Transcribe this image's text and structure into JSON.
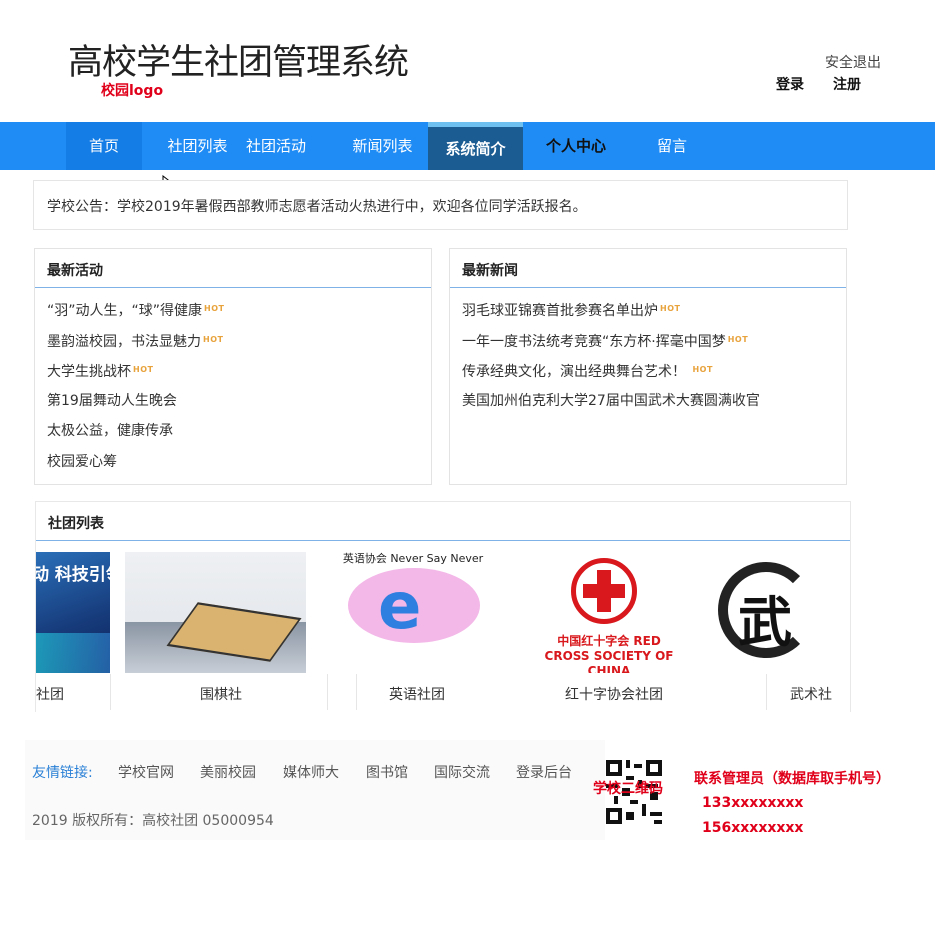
{
  "header": {
    "title": "高校学生社团管理系统",
    "logo_label": "校园logo",
    "logout": "安全退出",
    "login": "登录",
    "register": "注册"
  },
  "nav": {
    "items": [
      {
        "label": "首页"
      },
      {
        "label": "社团列表"
      },
      {
        "label": "社团活动"
      },
      {
        "label": "新闻列表"
      },
      {
        "label": "系统简介"
      },
      {
        "label": "个人中心"
      },
      {
        "label": "留言"
      }
    ],
    "colors": {
      "bar": "#1f8cf5",
      "selected": "#1b5c92"
    }
  },
  "notice": {
    "text": "学校公告：学校2019年暑假西部教师志愿者活动火热进行中，欢迎各位同学活跃报名。"
  },
  "activities": {
    "title": "最新活动",
    "items": [
      {
        "text": "“羽”动人生，“球”得健康",
        "hot": "HOT"
      },
      {
        "text": "墨韵溢校园，书法显魅力",
        "hot": "HOT"
      },
      {
        "text": "大学生挑战杯",
        "hot": "HOT"
      },
      {
        "text": "第19届舞动人生晚会",
        "hot": ""
      },
      {
        "text": "太极公益，健康传承",
        "hot": ""
      },
      {
        "text": "校园爱心筹",
        "hot": ""
      }
    ]
  },
  "news": {
    "title": "最新新闻",
    "items": [
      {
        "text": "羽毛球亚锦赛首批参赛名单出炉",
        "hot": "HOT"
      },
      {
        "text": "一年一度书法统考竞赛“东方杯·挥毫中国梦",
        "hot": "HOT"
      },
      {
        "text": "传承经典文化，演出经典舞台艺术！",
        "hot": "HOT"
      },
      {
        "text": "美国加州伯克利大学27届中国武术大赛圆满收官",
        "hot": ""
      }
    ]
  },
  "clubs": {
    "title": "社团列表",
    "items": [
      {
        "name": "社团",
        "image_text": "动 科技引领"
      },
      {
        "name": "围棋社",
        "image_text": ""
      },
      {
        "name": "英语社团",
        "image_text": "英语协会 Never Say Never"
      },
      {
        "name": "红十字协会社团",
        "image_text": "中国红十字会 RED CROSS SOCIETY OF CHINA"
      },
      {
        "name": "武术社",
        "image_text": "武"
      }
    ]
  },
  "footer": {
    "links_label": "友情链接:",
    "links": [
      "学校官网",
      "美丽校园",
      "媒体师大",
      "图书馆",
      "国际交流",
      "登录后台"
    ],
    "copyright": "2019 版权所有：高校社团 05000954",
    "qr_label": "学校二维码",
    "contact_title": "联系管理员（数据库取手机号）",
    "phones": [
      "133xxxxxxxx",
      "156xxxxxxxx"
    ]
  },
  "colors": {
    "accent": "#1f8cf5",
    "highlight_red": "#e0001a",
    "hot": "#e8a33d"
  }
}
